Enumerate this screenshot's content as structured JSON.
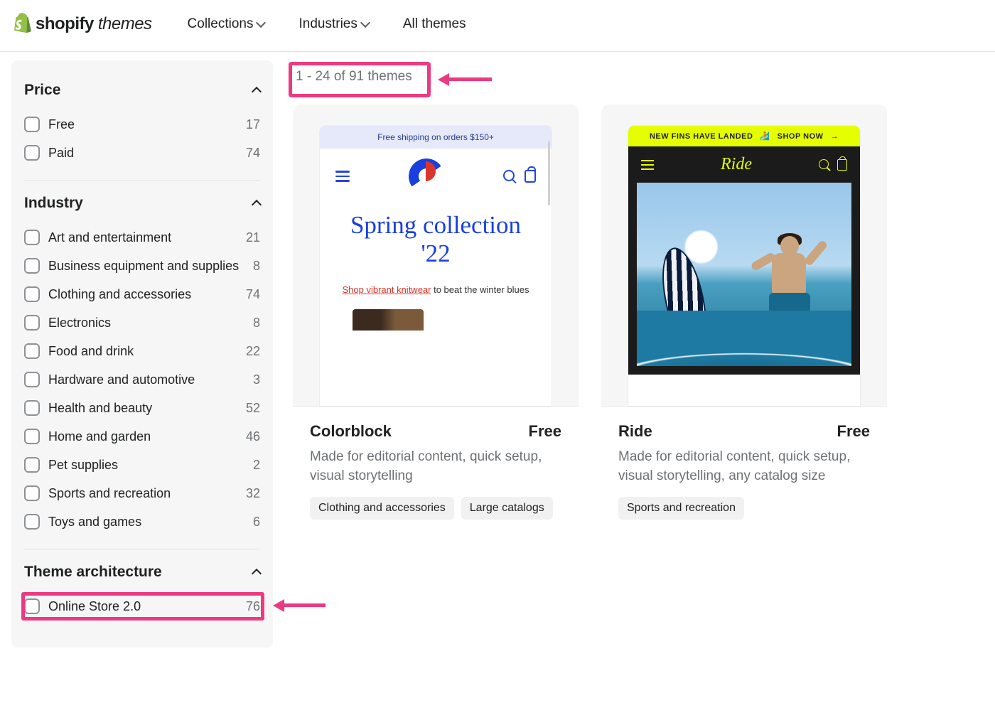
{
  "brand": {
    "bold": "shopify",
    "light": "themes"
  },
  "nav": [
    {
      "label": "Collections",
      "dropdown": true
    },
    {
      "label": "Industries",
      "dropdown": true
    },
    {
      "label": "All themes",
      "dropdown": false
    }
  ],
  "results_text": "1 - 24 of 91 themes",
  "filters": {
    "price": {
      "title": "Price",
      "items": [
        {
          "label": "Free",
          "count": 17
        },
        {
          "label": "Paid",
          "count": 74
        }
      ]
    },
    "industry": {
      "title": "Industry",
      "items": [
        {
          "label": "Art and entertainment",
          "count": 21
        },
        {
          "label": "Business equipment and supplies",
          "count": 8
        },
        {
          "label": "Clothing and accessories",
          "count": 74
        },
        {
          "label": "Electronics",
          "count": 8
        },
        {
          "label": "Food and drink",
          "count": 22
        },
        {
          "label": "Hardware and automotive",
          "count": 3
        },
        {
          "label": "Health and beauty",
          "count": 52
        },
        {
          "label": "Home and garden",
          "count": 46
        },
        {
          "label": "Pet supplies",
          "count": 2
        },
        {
          "label": "Sports and recreation",
          "count": 32
        },
        {
          "label": "Toys and games",
          "count": 6
        }
      ]
    },
    "theme_architecture": {
      "title": "Theme architecture",
      "items": [
        {
          "label": "Online Store 2.0",
          "count": 76
        }
      ]
    }
  },
  "cards": [
    {
      "preview": {
        "banner": "Free shipping on orders $150+",
        "hero_title": "Spring collection '22",
        "sub_link": "Shop vibrant knitwear",
        "sub_rest": " to beat the winter blues"
      },
      "name": "Colorblock",
      "price": "Free",
      "desc": "Made for editorial content, quick setup, visual storytelling",
      "tags": [
        "Clothing and accessories",
        "Large catalogs"
      ]
    },
    {
      "preview": {
        "banner_left": "NEW FINS HAVE LANDED",
        "banner_emoji": "🏄",
        "banner_right": "SHOP NOW",
        "logo": "Ride"
      },
      "name": "Ride",
      "price": "Free",
      "desc": "Made for editorial content, quick setup, visual storytelling, any catalog size",
      "tags": [
        "Sports and recreation"
      ]
    }
  ]
}
